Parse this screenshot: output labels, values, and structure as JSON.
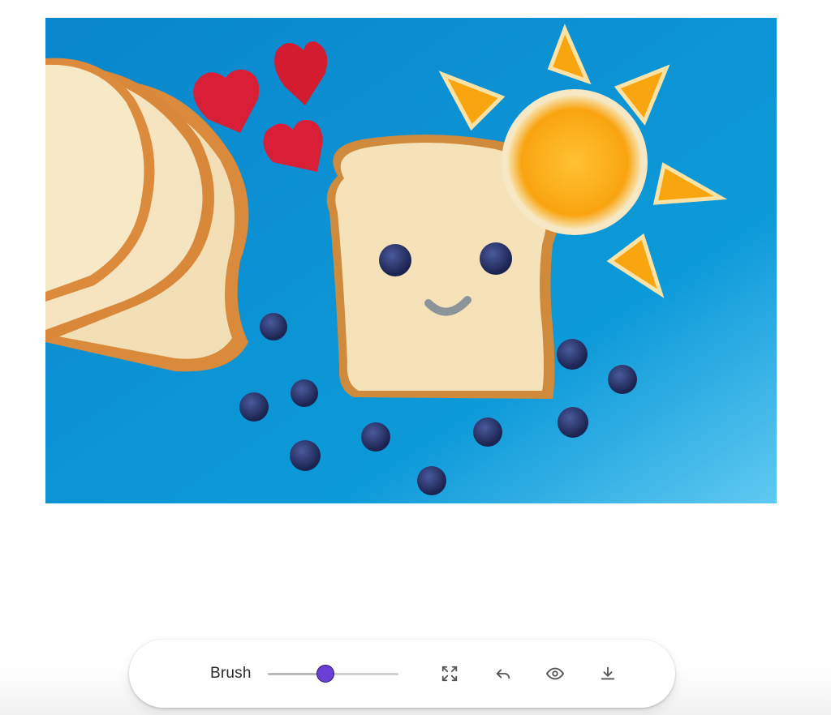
{
  "canvas": {
    "image_label": "photo-bread-face-blueberries-orange-sun"
  },
  "toolbar": {
    "brush_label": "Brush",
    "brush_size": 0.44,
    "icons": {
      "fit": "expand-icon",
      "undo": "undo-icon",
      "preview": "eye-icon",
      "download": "download-icon"
    }
  },
  "colors": {
    "thumb": "#6a3fd6",
    "background": "#0b8fd3",
    "icon": "#555555"
  }
}
